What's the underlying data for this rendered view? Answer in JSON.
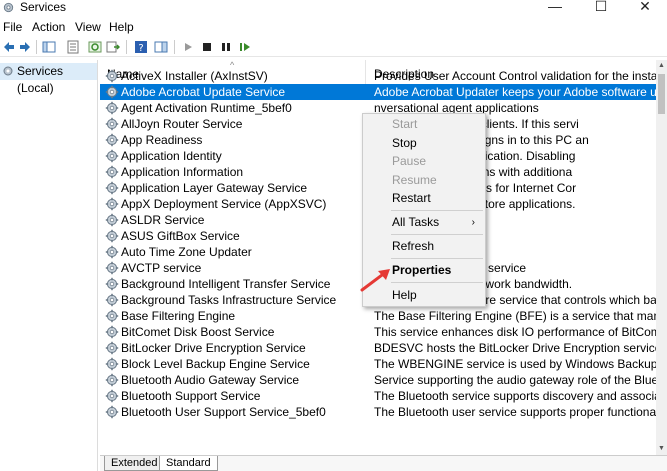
{
  "window": {
    "title": "Services",
    "controls": {
      "minimize": "—",
      "maximize": "☐",
      "close": "✕"
    }
  },
  "menu": [
    "File",
    "Action",
    "View",
    "Help"
  ],
  "tree": {
    "item": "Services (Local)"
  },
  "columns": {
    "name": "Name",
    "description": "Description"
  },
  "rows": [
    {
      "name": "ActiveX Installer (AxInstSV)",
      "desc": "Provides User Account Control validation for the installation of A"
    },
    {
      "name": "Adobe Acrobat Update Service",
      "desc": "Adobe Acrobat Updater keeps your Adobe software up to date."
    },
    {
      "name": "Agent Activation Runtime_5bef0",
      "desc": "nversational agent applications"
    },
    {
      "name": "AllJoyn Router Service",
      "desc": "for the local AllJoyn clients. If this servi"
    },
    {
      "name": "App Readiness",
      "desc": "he first time a user signs in to this PC an"
    },
    {
      "name": "Application Identity",
      "desc": "he identity of an application. Disabling"
    },
    {
      "name": "Application Information",
      "desc": "interactive applications with additiona"
    },
    {
      "name": "Application Layer Gateway Service",
      "desc": "party protocol plug-ins for Internet Cor"
    },
    {
      "name": "AppX Deployment Service (AppXSVC)",
      "desc": "pport for deploying Store applications."
    },
    {
      "name": "ASLDR Service",
      "desc": ""
    },
    {
      "name": "ASUS GiftBox Service",
      "desc": ""
    },
    {
      "name": "Auto Time Zone Updater",
      "desc": "stem time zone."
    },
    {
      "name": "AVCTP service",
      "desc": "ol Transport Protocol service"
    },
    {
      "name": "Background Intelligent Transfer Service",
      "desc": "ground using idle network bandwidth."
    },
    {
      "name": "Background Tasks Infrastructure Service",
      "desc": "Windows infrastructure service that controls which background"
    },
    {
      "name": "Base Filtering Engine",
      "desc": "The Base Filtering Engine (BFE) is a service that manages firewall"
    },
    {
      "name": "BitComet Disk Boost Service",
      "desc": "This service enhances disk IO performance of BitComet."
    },
    {
      "name": "BitLocker Drive Encryption Service",
      "desc": "BDESVC hosts the BitLocker Drive Encryption service. BitLocker D"
    },
    {
      "name": "Block Level Backup Engine Service",
      "desc": "The WBENGINE service is used by Windows Backup to perform b"
    },
    {
      "name": "Bluetooth Audio Gateway Service",
      "desc": "Service supporting the audio gateway role of the Bluetooth Han"
    },
    {
      "name": "Bluetooth Support Service",
      "desc": "The Bluetooth service supports discovery and association of rem"
    },
    {
      "name": "Bluetooth User Support Service_5bef0",
      "desc": "The Bluetooth user service supports proper functionality of Blue"
    }
  ],
  "context_menu": {
    "start": "Start",
    "stop": "Stop",
    "pause": "Pause",
    "resume": "Resume",
    "restart": "Restart",
    "all_tasks": "All Tasks",
    "all_tasks_arrow": "›",
    "refresh": "Refresh",
    "properties": "Properties",
    "help": "Help"
  },
  "tabs": [
    "Extended",
    "Standard"
  ],
  "colors": {
    "selection": "#0078d7",
    "tree_selection": "#dcecf9",
    "annotation_arrow": "#e53935"
  }
}
